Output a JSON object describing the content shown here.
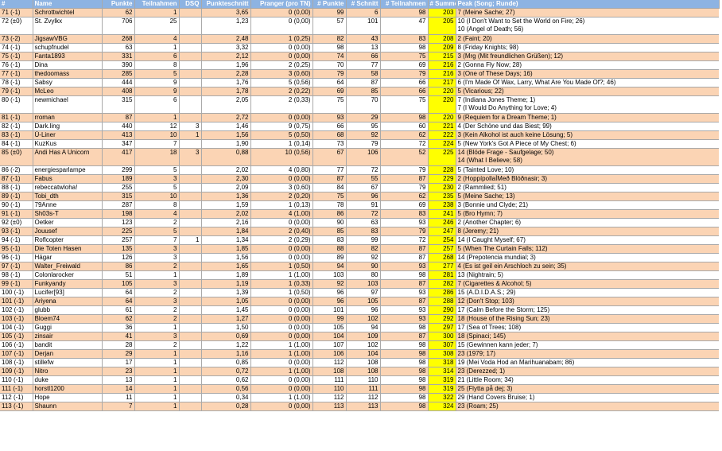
{
  "headers": [
    "#",
    "Name",
    "Punkte",
    "Teilnahmen",
    "DSQ",
    "Punkteschnitt",
    "Pranger (pro TN)",
    "# Punkte",
    "# Schnitt",
    "# Teilnahmen",
    "# Summe",
    "Peak (Song; Runde)"
  ],
  "rows": [
    [
      "71 (-1)",
      "Schrottwichtel",
      "62",
      "1",
      "",
      "3,65",
      "0 (0,00)",
      "99",
      "6",
      "98",
      "203",
      [
        "7 (Meine Sache; 27)"
      ]
    ],
    [
      "72 (±0)",
      "St. Zvylkx",
      "706",
      "25",
      "",
      "1,23",
      "0 (0,00)",
      "57",
      "101",
      "47",
      "205",
      [
        "10 (I Don't Want to Set the World on Fire; 26)",
        "10 (Angel of Death; 56)"
      ]
    ],
    [
      "73 (-2)",
      "JigsawVBG",
      "268",
      "4",
      "",
      "2,48",
      "1 (0,25)",
      "82",
      "43",
      "83",
      "208",
      [
        "2 (Faint; 20)"
      ]
    ],
    [
      "74 (-1)",
      "schupfnudel",
      "63",
      "1",
      "",
      "3,32",
      "0 (0,00)",
      "98",
      "13",
      "98",
      "209",
      [
        "8 (Friday Knights; 98)"
      ]
    ],
    [
      "75 (-1)",
      "Fanta1893",
      "331",
      "6",
      "",
      "2,12",
      "0 (0,00)",
      "74",
      "66",
      "75",
      "215",
      [
        "3 (Mrg (Mit freundlichen Grüßen); 12)"
      ]
    ],
    [
      "76 (-1)",
      "Dina",
      "390",
      "8",
      "",
      "1,96",
      "2 (0,25)",
      "70",
      "77",
      "69",
      "216",
      [
        "2 (Gonna Fly Now; 28)"
      ]
    ],
    [
      "77 (-1)",
      "thedoomass",
      "285",
      "5",
      "",
      "2,28",
      "3 (0,60)",
      "79",
      "58",
      "79",
      "216",
      [
        "3 (One of These Days; 16)"
      ]
    ],
    [
      "78 (-1)",
      "Sabsy",
      "444",
      "9",
      "",
      "1,76",
      "5 (0,56)",
      "64",
      "87",
      "66",
      "217",
      [
        "6 (I'm Made Of Wax, Larry, What Are You Made Of?; 46)"
      ]
    ],
    [
      "79 (-1)",
      "McLeo",
      "408",
      "9",
      "",
      "1,78",
      "2 (0,22)",
      "69",
      "85",
      "66",
      "220",
      [
        "5 (Vicarious; 22)"
      ]
    ],
    [
      "80 (-1)",
      "newmichael",
      "315",
      "6",
      "",
      "2,05",
      "2 (0,33)",
      "75",
      "70",
      "75",
      "220",
      [
        "7 (Indiana Jones Theme; 1)",
        "7 (I Would Do Anything for Love; 4)"
      ]
    ],
    [
      "81 (-1)",
      "rroman",
      "87",
      "1",
      "",
      "2,72",
      "0 (0,00)",
      "93",
      "29",
      "98",
      "220",
      [
        "9 (Requiem for a Dream Theme; 1)"
      ]
    ],
    [
      "82 (-1)",
      "Dark.ling",
      "440",
      "12",
      "3",
      "1,46",
      "9 (0,75)",
      "66",
      "95",
      "60",
      "221",
      [
        "4 (Der Schöne und das Biest; 99)"
      ]
    ],
    [
      "83 (-1)",
      "Ü-Liner",
      "413",
      "10",
      "1",
      "1,56",
      "5 (0,50)",
      "68",
      "92",
      "62",
      "222",
      [
        "3 (Kein Alkohol ist auch keine Lösung; 5)"
      ]
    ],
    [
      "84 (-1)",
      "KuzKus",
      "347",
      "7",
      "",
      "1,90",
      "1 (0,14)",
      "73",
      "79",
      "72",
      "224",
      [
        "5 (New York's Got A Piece of My Chest; 6)"
      ]
    ],
    [
      "85 (±0)",
      "Andi Has A Unicorn",
      "417",
      "18",
      "3",
      "0,88",
      "10 (0,56)",
      "67",
      "106",
      "52",
      "225",
      [
        "14 (Blöde Frage - Saufgelage; 50)",
        "14 (What I Believe; 58)"
      ]
    ],
    [
      "86 (-2)",
      "energiesparlampe",
      "299",
      "5",
      "",
      "2,02",
      "4 (0,80)",
      "77",
      "72",
      "79",
      "228",
      [
        "5 (Tainted Love; 10)"
      ]
    ],
    [
      "87 (-1)",
      "Fabus",
      "189",
      "3",
      "",
      "2,30",
      "0 (0,00)",
      "87",
      "55",
      "87",
      "229",
      [
        "2 (HoppípollaÍMeð Blóðnasir; 3)"
      ]
    ],
    [
      "88 (-1)",
      "rebeccatwloha!",
      "255",
      "5",
      "",
      "2,09",
      "3 (0,60)",
      "84",
      "67",
      "79",
      "230",
      [
        "2 (Rammlied; 51)"
      ]
    ],
    [
      "89 (-1)",
      "Tobi_dth",
      "315",
      "10",
      "",
      "1,36",
      "2 (0,20)",
      "75",
      "96",
      "62",
      "235",
      [
        "5 (Meine Sache; 13)"
      ]
    ],
    [
      "90 (-1)",
      "79Anne",
      "287",
      "8",
      "",
      "1,59",
      "1 (0,13)",
      "78",
      "91",
      "69",
      "238",
      [
        "3 (Bonnie und Clyde; 21)"
      ]
    ],
    [
      "91 (-1)",
      "Sh03s-T",
      "198",
      "4",
      "",
      "2,02",
      "4 (1,00)",
      "86",
      "72",
      "83",
      "241",
      [
        "5 (Bro Hymn; 7)"
      ]
    ],
    [
      "92 (±0)",
      "Oetker",
      "123",
      "2",
      "",
      "2,16",
      "0 (0,00)",
      "90",
      "63",
      "93",
      "246",
      [
        "2 (Another Chapter; 6)"
      ]
    ],
    [
      "93 (-1)",
      "Jouusef",
      "225",
      "5",
      "",
      "1,84",
      "2 (0,40)",
      "85",
      "83",
      "79",
      "247",
      [
        "8 (Jeremy; 21)"
      ]
    ],
    [
      "94 (-1)",
      "Roflcopter",
      "257",
      "7",
      "1",
      "1,34",
      "2 (0,29)",
      "83",
      "99",
      "72",
      "254",
      [
        "14 (I Caught Myself; 67)"
      ]
    ],
    [
      "95 (-1)",
      "Die Toten Hasen",
      "135",
      "3",
      "",
      "1,85",
      "0 (0,00)",
      "88",
      "82",
      "87",
      "257",
      [
        "5 (When The Curtain Falls; 112)"
      ]
    ],
    [
      "96 (-1)",
      "Hägar",
      "126",
      "3",
      "",
      "1,56",
      "0 (0,00)",
      "89",
      "92",
      "87",
      "268",
      [
        "14 (Prepotencia mundial; 3)"
      ]
    ],
    [
      "97 (-1)",
      "Walter_Freiwald",
      "86",
      "2",
      "",
      "1,65",
      "1 (0,50)",
      "94",
      "90",
      "93",
      "277",
      [
        "4 (Es ist geil ein Arschloch zu sein; 35)"
      ]
    ],
    [
      "98 (-1)",
      "Colonlarocker",
      "51",
      "1",
      "",
      "1,89",
      "1 (1,00)",
      "103",
      "80",
      "98",
      "281",
      [
        "13 (Nightrain; 5)"
      ]
    ],
    [
      "99 (-1)",
      "Funkyandy",
      "105",
      "3",
      "",
      "1,19",
      "1 (0,33)",
      "92",
      "103",
      "87",
      "282",
      [
        "7 (Cigarettes & Alcohol; 5)"
      ]
    ],
    [
      "100 (-1)",
      "Lucifer[93]",
      "64",
      "2",
      "",
      "1,39",
      "1 (0,50)",
      "96",
      "97",
      "93",
      "286",
      [
        "15 (A.D.I.D.A.S.; 29)"
      ]
    ],
    [
      "101 (-1)",
      "Ariyena",
      "64",
      "3",
      "",
      "1,05",
      "0 (0,00)",
      "96",
      "105",
      "87",
      "288",
      [
        "12 (Don't Stop; 103)"
      ]
    ],
    [
      "102 (-1)",
      "glubb",
      "61",
      "2",
      "",
      "1,45",
      "0 (0,00)",
      "101",
      "96",
      "93",
      "290",
      [
        "17 (Calm Before the Storm; 125)"
      ]
    ],
    [
      "103 (-1)",
      "Bloem74",
      "62",
      "2",
      "",
      "1,27",
      "0 (0,00)",
      "99",
      "102",
      "93",
      "292",
      [
        "18 (House of the Rising Sun; 23)"
      ]
    ],
    [
      "104 (-1)",
      "Guggi",
      "36",
      "1",
      "",
      "1,50",
      "0 (0,00)",
      "105",
      "94",
      "98",
      "297",
      [
        "17 (Sea of Trees; 108)"
      ]
    ],
    [
      "105 (-1)",
      "zinsair",
      "41",
      "3",
      "",
      "0,69",
      "0 (0,00)",
      "104",
      "109",
      "87",
      "300",
      [
        "18 (Spinaci; 145)"
      ]
    ],
    [
      "106 (-1)",
      "bandit",
      "28",
      "2",
      "",
      "1,22",
      "1 (1,00)",
      "107",
      "102",
      "98",
      "307",
      [
        "15 (Gewinnen kann jeder; 7)"
      ]
    ],
    [
      "107 (-1)",
      "Derjan",
      "29",
      "1",
      "",
      "1,16",
      "1 (1,00)",
      "106",
      "104",
      "98",
      "308",
      [
        "23 (1979; 17)"
      ]
    ],
    [
      "108 (-1)",
      "stillefw",
      "17",
      "1",
      "",
      "0,85",
      "0 (0,00)",
      "112",
      "108",
      "98",
      "318",
      [
        "19 (Mei Voda Hod an Marihuanabam; 86)"
      ]
    ],
    [
      "109 (-1)",
      "Nitro",
      "23",
      "1",
      "",
      "0,72",
      "1 (1,00)",
      "108",
      "108",
      "98",
      "314",
      [
        "23 (Derezzed; 1)"
      ]
    ],
    [
      "110 (-1)",
      "duke",
      "13",
      "1",
      "",
      "0,62",
      "0 (0,00)",
      "111",
      "110",
      "98",
      "319",
      [
        "21 (Little Room; 34)"
      ]
    ],
    [
      "111 (-1)",
      "horstl1200",
      "14",
      "1",
      "",
      "0,56",
      "0 (0,00)",
      "110",
      "111",
      "98",
      "319",
      [
        "25 (Flytta på dej; 3)"
      ]
    ],
    [
      "112 (-1)",
      "Hope",
      "11",
      "1",
      "",
      "0,34",
      "1 (1,00)",
      "112",
      "112",
      "98",
      "322",
      [
        "29 (Hand Covers Bruise; 1)"
      ]
    ],
    [
      "113 (-1)",
      "Shaunn",
      "7",
      "1",
      "",
      "0,28",
      "0 (0,00)",
      "113",
      "113",
      "98",
      "324",
      [
        "23 (Roam; 25)"
      ]
    ]
  ]
}
